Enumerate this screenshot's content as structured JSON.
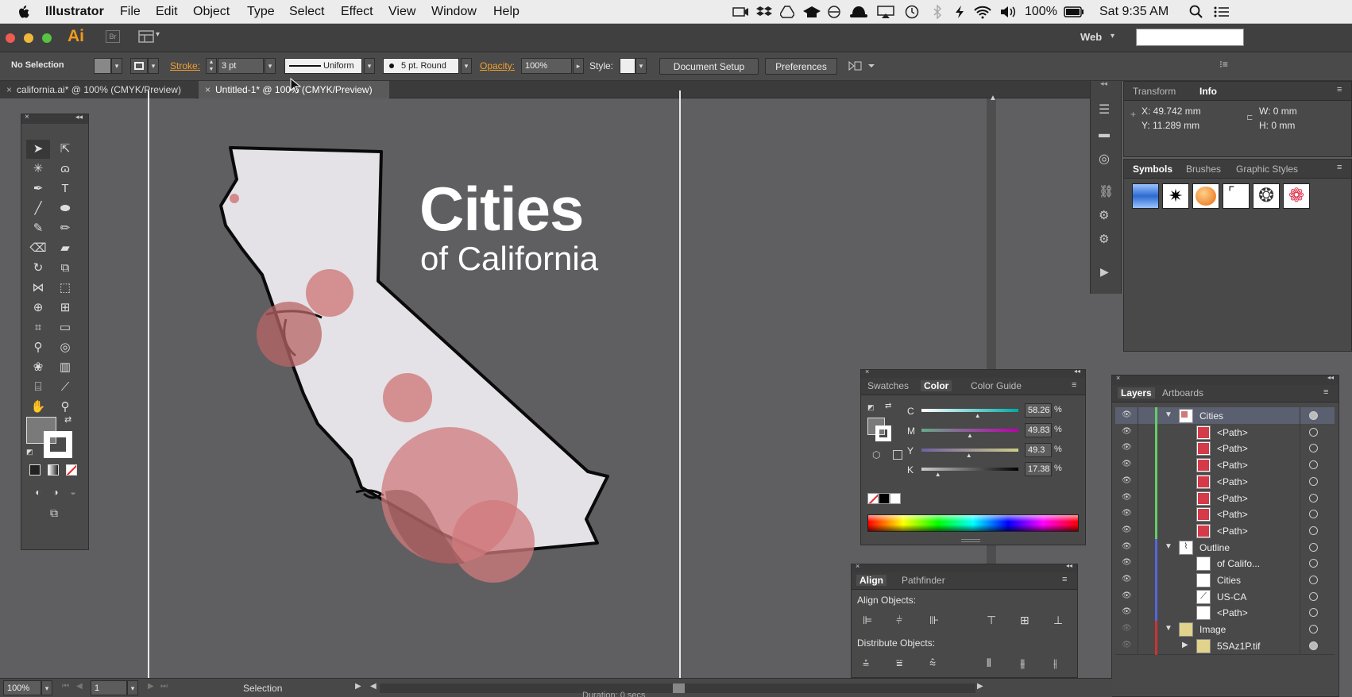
{
  "menubar": {
    "apple": "",
    "app": "Illustrator",
    "items": [
      "File",
      "Edit",
      "Object",
      "Type",
      "Select",
      "Effect",
      "View",
      "Window",
      "Help"
    ],
    "battery": "100%",
    "clock": "Sat 9:35 AM"
  },
  "appbar": {
    "logo": "Ai",
    "bridge": "Br",
    "workspace": "Web",
    "workspace_caret": "▾",
    "arrange_caret": "▾"
  },
  "control": {
    "selection": "No Selection",
    "stroke_label": "Stroke:",
    "stroke_value": "3 pt",
    "profile": "Uniform",
    "brush": "5 pt. Round",
    "opacity_label": "Opacity:",
    "opacity_value": "100%",
    "style_label": "Style:",
    "doc_setup": "Document Setup",
    "preferences": "Preferences"
  },
  "tabs": [
    {
      "label": "california.ai* @ 100% (CMYK/Preview)",
      "close": "×"
    },
    {
      "label": "Untitled-1* @ 100% (CMYK/Preview)",
      "close": "×"
    }
  ],
  "artwork": {
    "title": "Cities",
    "subtitle": "of California",
    "colors": {
      "state_fill": "#e4e2e6",
      "outline": "#0a0a0a",
      "circle": "#d07a7c"
    }
  },
  "transform_panel": {
    "tabs": [
      "Transform",
      "Info"
    ],
    "active": "Info",
    "x": "X: 49.742 mm",
    "y": "Y: 11.289 mm",
    "w": "W: 0 mm",
    "h": "H: 0 mm"
  },
  "symbols_panel": {
    "tabs": [
      "Symbols",
      "Brushes",
      "Graphic Styles"
    ],
    "active": "Symbols"
  },
  "color_panel": {
    "tabs": [
      "Swatches",
      "Color",
      "Color Guide"
    ],
    "active": "Color",
    "channels": [
      {
        "label": "C",
        "value": "58.26",
        "pct": 0.58,
        "unit": "%"
      },
      {
        "label": "M",
        "value": "49.83",
        "pct": 0.5,
        "unit": "%"
      },
      {
        "label": "Y",
        "value": "49.3",
        "pct": 0.49,
        "unit": "%"
      },
      {
        "label": "K",
        "value": "17.38",
        "pct": 0.17,
        "unit": "%"
      }
    ]
  },
  "align_panel": {
    "tabs": [
      "Align",
      "Pathfinder"
    ],
    "active": "Align",
    "align_objects": "Align Objects:",
    "distribute_objects": "Distribute Objects:"
  },
  "layers_panel": {
    "tabs": [
      "Layers",
      "Artboards"
    ],
    "active": "Layers",
    "rows": [
      {
        "name": "Cities",
        "level": 0,
        "expanded": true,
        "color": "#66cc66",
        "thumb": "cities",
        "selected": true
      },
      {
        "name": "<Path>",
        "level": 1,
        "color": "#66cc66",
        "thumb": "red"
      },
      {
        "name": "<Path>",
        "level": 1,
        "color": "#66cc66",
        "thumb": "red"
      },
      {
        "name": "<Path>",
        "level": 1,
        "color": "#66cc66",
        "thumb": "red"
      },
      {
        "name": "<Path>",
        "level": 1,
        "color": "#66cc66",
        "thumb": "red"
      },
      {
        "name": "<Path>",
        "level": 1,
        "color": "#66cc66",
        "thumb": "red"
      },
      {
        "name": "<Path>",
        "level": 1,
        "color": "#66cc66",
        "thumb": "red"
      },
      {
        "name": "<Path>",
        "level": 1,
        "color": "#66cc66",
        "thumb": "red"
      },
      {
        "name": "Outline",
        "level": 0,
        "expanded": true,
        "color": "#5566dd",
        "thumb": "outline"
      },
      {
        "name": "of Califo...",
        "level": 1,
        "color": "#5566dd",
        "thumb": "white"
      },
      {
        "name": "Cities",
        "level": 1,
        "color": "#5566dd",
        "thumb": "white"
      },
      {
        "name": "US-CA",
        "level": 1,
        "color": "#5566dd",
        "thumb": "map"
      },
      {
        "name": "<Path>",
        "level": 1,
        "color": "#5566dd",
        "thumb": "white"
      },
      {
        "name": "Image",
        "level": 0,
        "expanded": true,
        "color": "#cc3333",
        "thumb": "image",
        "eye_hidden": true
      },
      {
        "name": "5SAz1P.tif",
        "level": 1,
        "collapsed_child": true,
        "color": "#cc3333",
        "thumb": "image",
        "eye_hidden": true
      }
    ]
  },
  "status": {
    "zoom": "100%",
    "artboard": "1",
    "tool": "Selection",
    "duration": "Duration: 0 secs"
  }
}
